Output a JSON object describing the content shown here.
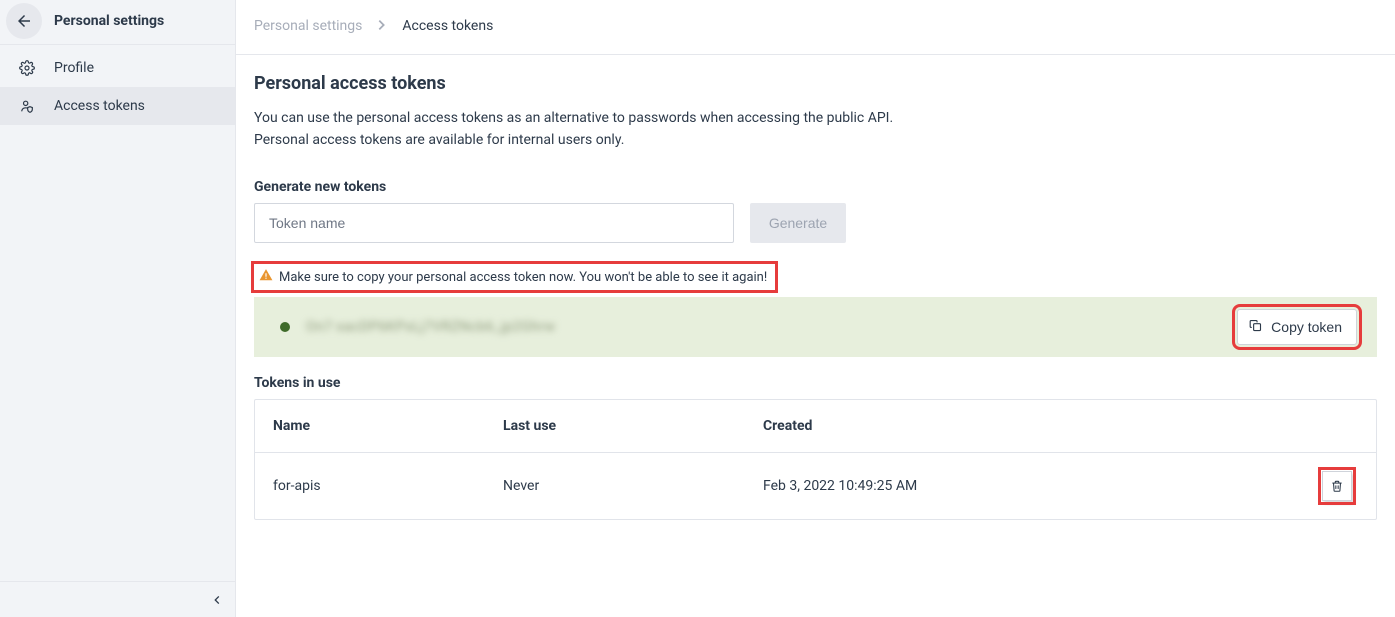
{
  "sidebar": {
    "title": "Personal settings",
    "items": [
      {
        "label": "Profile",
        "icon": "gear-icon",
        "active": false
      },
      {
        "label": "Access tokens",
        "icon": "user-shield-icon",
        "active": true
      }
    ]
  },
  "breadcrumb": {
    "root": "Personal settings",
    "current": "Access tokens"
  },
  "page": {
    "title": "Personal access tokens",
    "description_line1": "You can use the personal access tokens as an alternative to passwords when accessing the public API.",
    "description_line2": "Personal access tokens are available for internal users only.",
    "generate_label": "Generate new tokens",
    "input_placeholder": "Token name",
    "generate_button": "Generate",
    "warning_text": "Make sure to copy your personal access token now. You won't be able to see it again!",
    "token_blurred_placeholder": "On7·xacDP6KPxLj7VRZNcb6_jp2Ghrw",
    "copy_button": "Copy token",
    "tokens_in_use_label": "Tokens in use",
    "table": {
      "headers": {
        "name": "Name",
        "last_use": "Last use",
        "created": "Created"
      },
      "rows": [
        {
          "name": "for-apis",
          "last_use": "Never",
          "created": "Feb 3, 2022 10:49:25 AM"
        }
      ]
    }
  }
}
